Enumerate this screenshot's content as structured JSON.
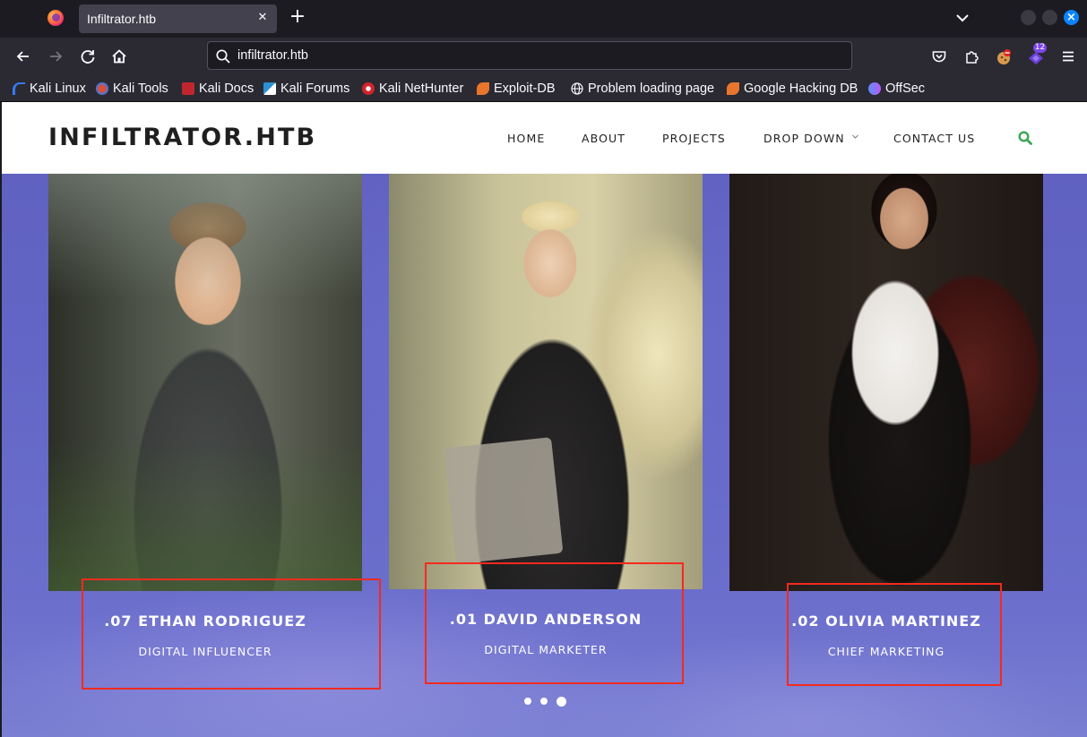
{
  "browser": {
    "tab": {
      "title": "Infiltrator.htb",
      "close_glyph": "✕"
    },
    "new_tab_glyph": "+",
    "url": "infiltrator.htb",
    "extension_badge": "12",
    "bookmarks": [
      {
        "label": "Kali Linux",
        "icon_color": "#367bf0"
      },
      {
        "label": "Kali Tools",
        "icon_color": "#e34c2f"
      },
      {
        "label": "Kali Docs",
        "icon_color": "#c0262d"
      },
      {
        "label": "Kali Forums",
        "icon_color": "#2d8fd5"
      },
      {
        "label": "Kali NetHunter",
        "icon_color": "#d0252c"
      },
      {
        "label": "Exploit-DB",
        "icon_color": "#e8762c"
      },
      {
        "label": "Problem loading page",
        "icon_color": "#c7c7cc"
      },
      {
        "label": "Google Hacking DB",
        "icon_color": "#e8762c"
      },
      {
        "label": "OffSec",
        "icon_color": "#5c8df6"
      }
    ]
  },
  "site": {
    "logo": "INFILTRATOR.HTB",
    "menu": [
      "HOME",
      "ABOUT",
      "PROJECTS",
      "DROP DOWN",
      "CONTACT US"
    ],
    "search_color": "#3aa655"
  },
  "team": [
    {
      "name": ".07 ETHAN RODRIGUEZ",
      "role": "DIGITAL INFLUENCER"
    },
    {
      "name": ".01 DAVID ANDERSON",
      "role": "DIGITAL MARKETER"
    },
    {
      "name": ".02 OLIVIA MARTINEZ",
      "role": "CHIEF MARKETING"
    }
  ],
  "carousel": {
    "dot_count": 3,
    "active_index": 2
  },
  "colors": {
    "highlight": "#f22b1f",
    "accent": "#0a84ff"
  }
}
